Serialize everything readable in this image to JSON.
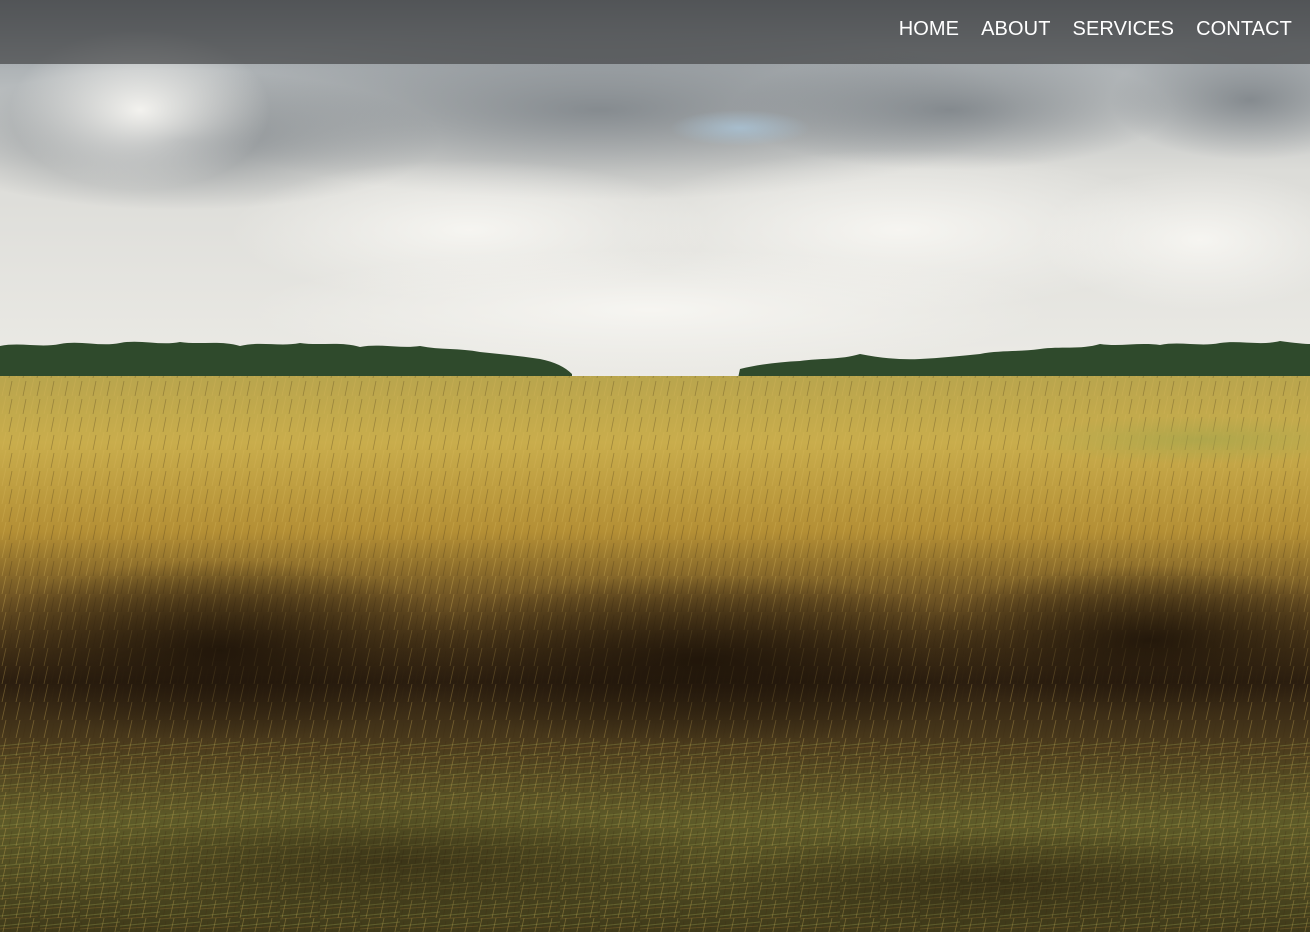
{
  "nav": {
    "items": [
      {
        "label": "HOME"
      },
      {
        "label": "ABOUT"
      },
      {
        "label": "SERVICES"
      },
      {
        "label": "CONTACT"
      }
    ],
    "text_color": "#ffffff",
    "bar_color": "#46484a"
  },
  "hero": {
    "image_subject": "wheat-field-under-cloudy-sky",
    "colors": {
      "sky": "#e6e6e2",
      "cloud_dark": "#7f8489",
      "treeline": "#2f4a2c",
      "wheat_light": "#c7a84a",
      "wheat_dark": "#3a2a14"
    }
  }
}
